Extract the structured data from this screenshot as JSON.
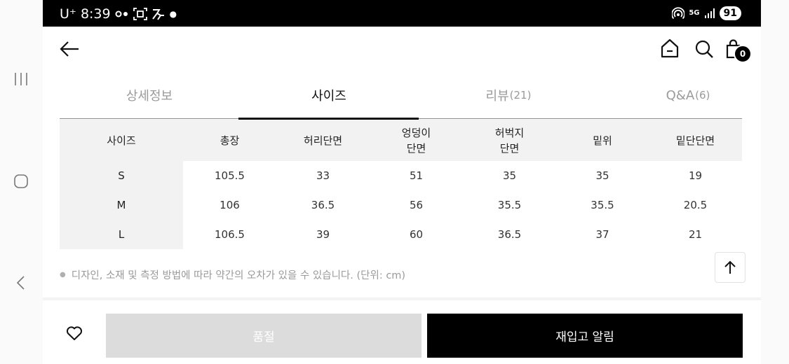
{
  "status_bar": {
    "carrier": "U⁺",
    "time": "8:39",
    "network": "5G",
    "battery": "91"
  },
  "cart": {
    "count": "0"
  },
  "tabs": [
    {
      "label": "상세정보",
      "count": ""
    },
    {
      "label": "사이즈",
      "count": ""
    },
    {
      "label": "리뷰",
      "count": "(21)"
    },
    {
      "label": "Q&A",
      "count": "(6)"
    }
  ],
  "active_tab": 1,
  "size_table": {
    "headers": [
      "사이즈",
      "총장",
      "허리단면",
      "엉덩이\n단면",
      "허벅지\n단면",
      "밑위",
      "밑단단면"
    ],
    "rows": [
      [
        "S",
        "105.5",
        "33",
        "51",
        "35",
        "35",
        "19"
      ],
      [
        "M",
        "106",
        "36.5",
        "56",
        "35.5",
        "35.5",
        "20.5"
      ],
      [
        "L",
        "106.5",
        "39",
        "60",
        "36.5",
        "37",
        "21"
      ]
    ]
  },
  "note": "디자인, 소재 및 측정 방법에 따라 약간의 오차가 있을 수 있습니다. (단위: cm)",
  "bottom_bar": {
    "soldout_label": "품절",
    "restock_label": "재입고 알림"
  },
  "colors": {
    "accent": "#000000",
    "disabled_button": "#dcdcdc",
    "table_header_bg": "#f2f2f2"
  }
}
